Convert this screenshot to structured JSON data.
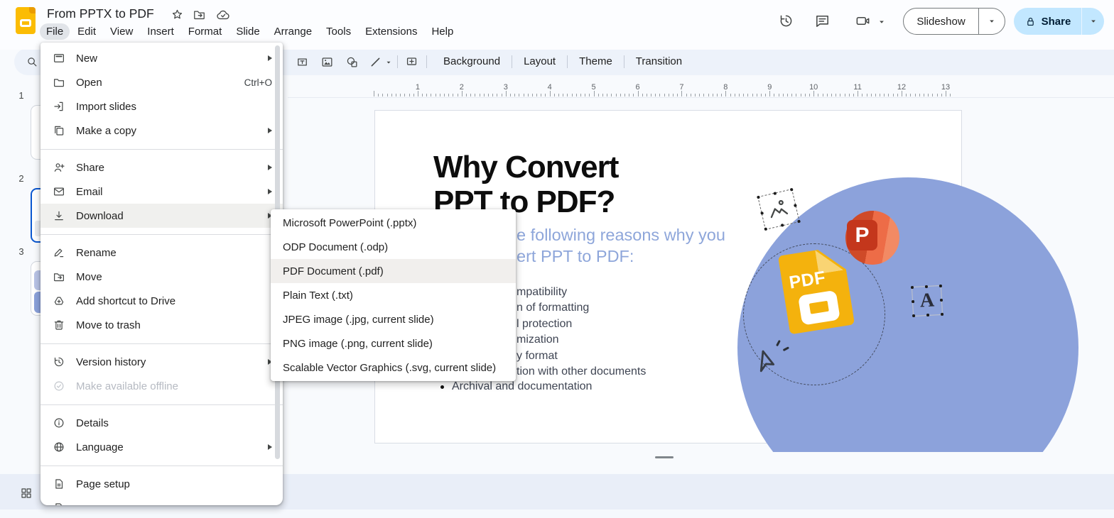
{
  "header": {
    "doc_title": "From PPTX to PDF",
    "title_icons": [
      "star-icon",
      "move-folder-icon",
      "cloud-saved-icon"
    ],
    "menus": [
      {
        "label": "File",
        "active": true
      },
      {
        "label": "Edit"
      },
      {
        "label": "View"
      },
      {
        "label": "Insert"
      },
      {
        "label": "Format"
      },
      {
        "label": "Slide"
      },
      {
        "label": "Arrange"
      },
      {
        "label": "Tools"
      },
      {
        "label": "Extensions"
      },
      {
        "label": "Help"
      }
    ],
    "right": {
      "icons": [
        "version-history-icon",
        "comments-icon",
        "camera-presentation-icon"
      ],
      "slideshow_label": "Slideshow",
      "share_label": "Share"
    }
  },
  "toolbar": {
    "insert_icons": [
      "search-icon",
      "text-box-icon",
      "insert-image-icon",
      "insert-shape-icon",
      "insert-line-icon",
      "insert-comment-icon"
    ],
    "buttons": [
      "Background",
      "Layout",
      "Theme",
      "Transition"
    ]
  },
  "ruler": {
    "numbers": [
      "1",
      "2",
      "3",
      "4",
      "5",
      "6",
      "7",
      "8",
      "9",
      "10",
      "11",
      "12",
      "13"
    ]
  },
  "filmstrip": {
    "slides": [
      {
        "number": "1",
        "selected": false
      },
      {
        "number": "2",
        "selected": true
      },
      {
        "number": "3",
        "selected": false
      }
    ]
  },
  "file_menu": {
    "items": [
      {
        "label": "New",
        "icon": "new-presentation-icon",
        "submenu": true
      },
      {
        "label": "Open",
        "icon": "open-folder-icon",
        "shortcut": "Ctrl+O"
      },
      {
        "label": "Import slides",
        "icon": "import-slides-icon"
      },
      {
        "label": "Make a copy",
        "icon": "make-copy-icon",
        "submenu": true
      },
      {
        "divider": true
      },
      {
        "label": "Share",
        "icon": "share-person-icon",
        "submenu": true
      },
      {
        "label": "Email",
        "icon": "email-icon",
        "submenu": true
      },
      {
        "label": "Download",
        "icon": "download-icon",
        "submenu": true,
        "highlighted": true
      },
      {
        "divider": true
      },
      {
        "label": "Rename",
        "icon": "rename-icon"
      },
      {
        "label": "Move",
        "icon": "move-folder-icon"
      },
      {
        "label": "Add shortcut to Drive",
        "icon": "drive-shortcut-icon"
      },
      {
        "label": "Move to trash",
        "icon": "trash-icon"
      },
      {
        "divider": true
      },
      {
        "label": "Version history",
        "icon": "version-history-icon",
        "submenu": true
      },
      {
        "label": "Make available offline",
        "icon": "offline-check-icon",
        "disabled": true
      },
      {
        "divider": true
      },
      {
        "label": "Details",
        "icon": "info-icon"
      },
      {
        "label": "Language",
        "icon": "globe-icon",
        "submenu": true
      },
      {
        "divider": true
      },
      {
        "label": "Page setup",
        "icon": "page-icon"
      },
      {
        "label": "",
        "icon": "page-icon",
        "clipped": true
      }
    ]
  },
  "download_submenu": {
    "items": [
      {
        "label": "Microsoft PowerPoint (.pptx)"
      },
      {
        "label": "ODP Document (.odp)"
      },
      {
        "label": "PDF Document (.pdf)",
        "highlighted": true
      },
      {
        "label": "Plain Text (.txt)"
      },
      {
        "label": "JPEG image (.jpg, current slide)"
      },
      {
        "label": "PNG image (.png, current slide)"
      },
      {
        "label": "Scalable Vector Graphics (.svg, current slide)"
      }
    ]
  },
  "slide": {
    "title_line1": "Why Convert",
    "title_line2": "PPT to PDF?",
    "subtitle_fragments": [
      "e following reasons why you",
      "ert PPT to PDF:"
    ],
    "bullet_fragments": [
      "mpatibility",
      "n of formatting",
      "l protection",
      "mization",
      "y format",
      "tion with other documents"
    ],
    "last_bullet": "Archival and documentation",
    "pdf_badge_text": "PDF",
    "powerpoint_letter": "P",
    "text_object_letter": "A"
  },
  "colors": {
    "toolbar_band": "#edf2fa",
    "share_pill": "#c2e7ff",
    "selected_slide_border": "#0b57d0",
    "hero_circle": "#8ca2db",
    "subtitle_blue": "#8ea6da",
    "slides_yellow": "#f4b20d",
    "powerpoint_red": "#c4371c",
    "powerpoint_orange": "#ed6c47",
    "menu_highlight": "#f0f0ee"
  }
}
